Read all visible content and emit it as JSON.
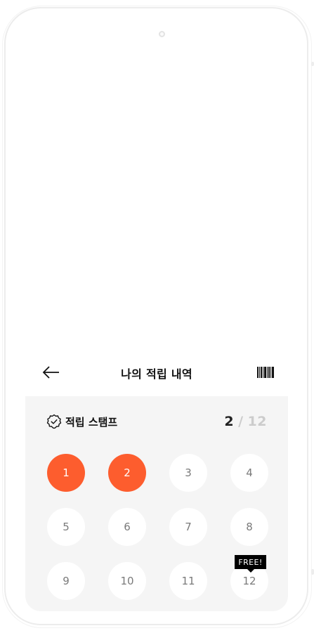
{
  "header": {
    "title": "나의 적립 내역",
    "back_icon": "arrow-left-icon",
    "barcode_icon": "barcode-icon"
  },
  "stamps": {
    "label": "적립 스탬프",
    "label_icon": "badge-check-icon",
    "current": "2",
    "separator": "/",
    "total": "12",
    "items": [
      {
        "number": "1",
        "filled": true
      },
      {
        "number": "2",
        "filled": true
      },
      {
        "number": "3",
        "filled": false
      },
      {
        "number": "4",
        "filled": false
      },
      {
        "number": "5",
        "filled": false
      },
      {
        "number": "6",
        "filled": false
      },
      {
        "number": "7",
        "filled": false
      },
      {
        "number": "8",
        "filled": false
      },
      {
        "number": "9",
        "filled": false
      },
      {
        "number": "10",
        "filled": false
      },
      {
        "number": "11",
        "filled": false
      },
      {
        "number": "12",
        "filled": false
      }
    ],
    "free_tag": "FREE!"
  },
  "colors": {
    "accent": "#fd5d2e",
    "panel_background": "#f5f5f5"
  }
}
